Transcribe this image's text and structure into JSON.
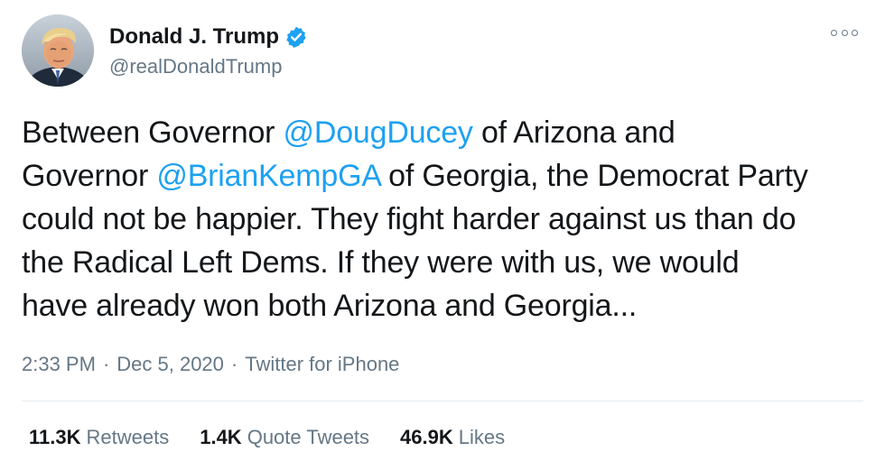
{
  "author": {
    "display_name": "Donald J. Trump",
    "handle": "@realDonaldTrump",
    "verified_icon": "verified-badge-icon",
    "accent": "#1da1f2"
  },
  "tweet": {
    "line1_a": "Between Governor ",
    "mention1": "@DougDucey",
    "line1_b": " of Arizona and",
    "line2_a": "Governor ",
    "mention2": "@BrianKempGA",
    "line2_b": " of Georgia, the Democrat Party",
    "line3": "could not be happier. They fight harder against us than do",
    "line4": "the Radical Left Dems. If they were with us, we would",
    "line5": "have already won both Arizona and Georgia..."
  },
  "meta": {
    "time": "2:33 PM",
    "separator": "·",
    "date": "Dec 5, 2020",
    "separator2": "·",
    "source": "Twitter for iPhone"
  },
  "stats": {
    "retweets_count": "11.3K",
    "retweets_label": "Retweets",
    "quotes_count": "1.4K",
    "quotes_label": "Quote Tweets",
    "likes_count": "46.9K",
    "likes_label": "Likes"
  },
  "colors": {
    "text": "#14171a",
    "secondary": "#657786",
    "link": "#1da1f2",
    "divider": "#e6ecf0"
  }
}
